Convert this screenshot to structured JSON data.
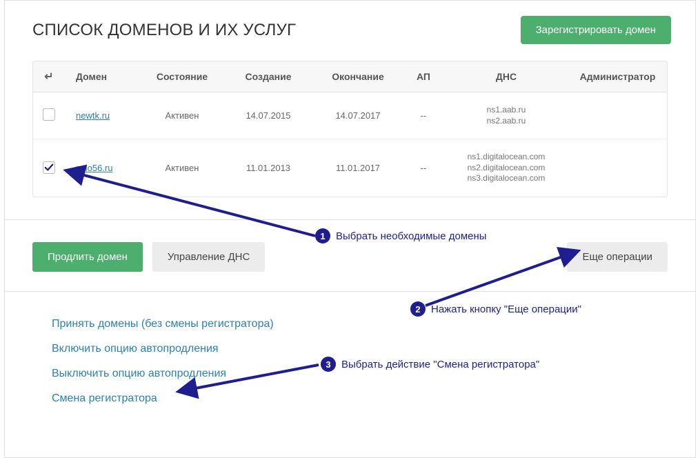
{
  "header": {
    "title": "СПИСОК ДОМЕНОВ И ИХ УСЛУГ",
    "register_button": "Зарегистрировать домен"
  },
  "table": {
    "columns": {
      "domain": "Домен",
      "status": "Состояние",
      "created": "Создание",
      "expires": "Окончание",
      "ap": "АП",
      "dns": "ДНС",
      "admin": "Администратор"
    },
    "rows": [
      {
        "checked": false,
        "domain": "newtk.ru",
        "status": "Активен",
        "created": "14.07.2015",
        "expires": "14.07.2017",
        "ap": "--",
        "dns": [
          "ns1.aab.ru",
          "ns2.aab.ru"
        ],
        "admin": ""
      },
      {
        "checked": true,
        "domain": "solo56.ru",
        "status": "Активен",
        "created": "11.01.2013",
        "expires": "11.01.2017",
        "ap": "--",
        "dns": [
          "ns1.digitalocean.com",
          "ns2.digitalocean.com",
          "ns3.digitalocean.com"
        ],
        "admin": ""
      }
    ]
  },
  "actions": {
    "renew": "Продлить домен",
    "manage_dns": "Управление ДНС",
    "more": "Еще операции"
  },
  "dropdown": {
    "items": [
      "Принять домены (без смены регистратора)",
      "Включить опцию автопродления",
      "Выключить опцию автопродления",
      "Смена регистратора"
    ]
  },
  "annotations": {
    "step1": "Выбрать необходимые домены",
    "step2": "Нажать кнопку \"Еще операции\"",
    "step3": "Выбрать действие \"Смена регистратора\""
  }
}
